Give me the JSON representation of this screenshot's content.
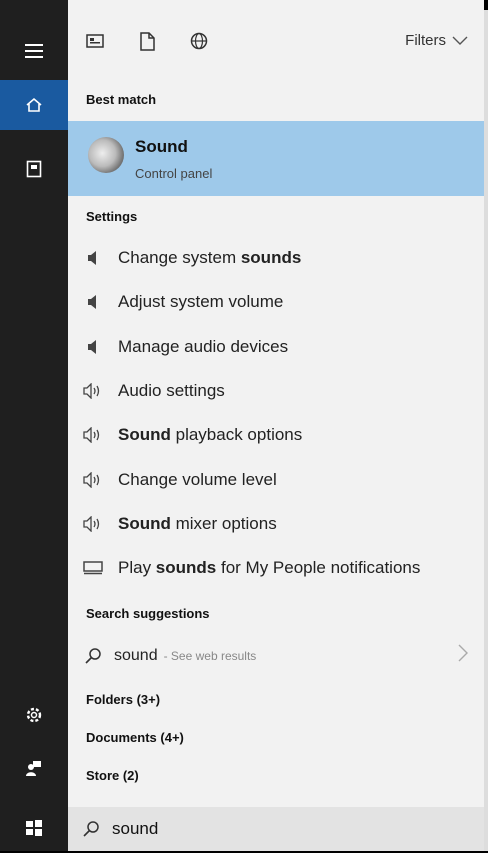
{
  "filters_label": "Filters",
  "best_match": {
    "heading": "Best match",
    "title": "Sound",
    "subtitle": "Control panel"
  },
  "settings": {
    "heading": "Settings",
    "items": [
      {
        "pre": "Change system ",
        "bold": "sounds",
        "post": "",
        "icon": "speaker-icon"
      },
      {
        "pre": "Adjust system volume",
        "bold": "",
        "post": "",
        "icon": "speaker-icon"
      },
      {
        "pre": "Manage audio devices",
        "bold": "",
        "post": "",
        "icon": "speaker-icon"
      },
      {
        "pre": "Audio settings",
        "bold": "",
        "post": "",
        "icon": "volume-icon"
      },
      {
        "pre": "",
        "bold": "Sound",
        "post": " playback options",
        "icon": "volume-icon"
      },
      {
        "pre": "Change volume level",
        "bold": "",
        "post": "",
        "icon": "volume-icon"
      },
      {
        "pre": "",
        "bold": "Sound",
        "post": " mixer options",
        "icon": "volume-icon"
      },
      {
        "pre": "Play ",
        "bold": "sounds",
        "post": " for My People notifications",
        "icon": "monitor-icon"
      }
    ]
  },
  "search_suggestions": {
    "heading": "Search suggestions",
    "query": "sound",
    "web_label": "- See web results"
  },
  "folders_label": "Folders (3+)",
  "documents_label": "Documents (4+)",
  "store_label": "Store (2)",
  "search": {
    "value": "sound"
  }
}
